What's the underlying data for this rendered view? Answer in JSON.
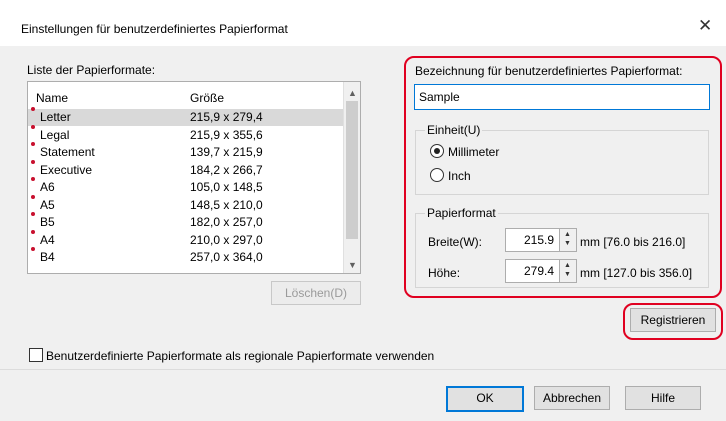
{
  "window": {
    "title": "Einstellungen für benutzerdefiniertes Papierformat",
    "close_icon": "close-icon"
  },
  "list": {
    "label": "Liste der Papierformate:",
    "col_name": "Name",
    "col_size": "Größe",
    "items": [
      {
        "name": "Letter",
        "size": "215,9 x 279,4"
      },
      {
        "name": "Legal",
        "size": "215,9 x 355,6"
      },
      {
        "name": "Statement",
        "size": "139,7 x 215,9"
      },
      {
        "name": "Executive",
        "size": "184,2 x 266,7"
      },
      {
        "name": "A6",
        "size": "105,0 x 148,5"
      },
      {
        "name": "A5",
        "size": "148,5 x 210,0"
      },
      {
        "name": "B5",
        "size": "182,0 x 257,0"
      },
      {
        "name": "A4",
        "size": "210,0 x 297,0"
      },
      {
        "name": "B4",
        "size": "257,0 x 364,0"
      }
    ],
    "delete_label": "Löschen(D)"
  },
  "custom": {
    "name_label": "Bezeichnung für benutzerdefiniertes Papierformat:",
    "name_value": "Sample",
    "unit_label": "Einheit(U)",
    "unit_mm": "Millimeter",
    "unit_inch": "Inch",
    "unit_selected": "Millimeter",
    "format_label": "Papierformat",
    "width_label": "Breite(W):",
    "width_value": "215.9",
    "width_range": "mm [76.0 bis 216.0]",
    "height_label": "Höhe:",
    "height_value": "279.4",
    "height_range": "mm [127.0 bis 356.0]",
    "register_label": "Registrieren"
  },
  "footer": {
    "checkbox_label": "Benutzerdefinierte Papierformate als regionale Papierformate verwenden",
    "ok": "OK",
    "cancel": "Abbrechen",
    "help": "Hilfe"
  }
}
